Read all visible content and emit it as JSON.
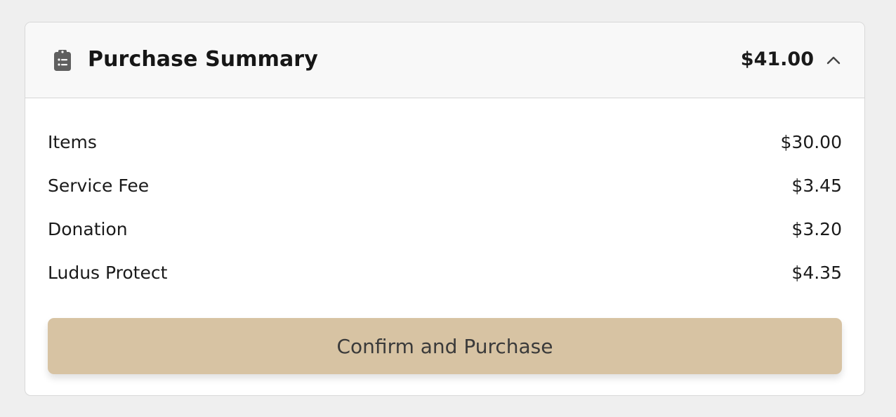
{
  "summary": {
    "title": "Purchase Summary",
    "total": "$41.00",
    "header_icon": "clipboard-list-icon",
    "toggle_icon": "chevron-up-icon",
    "rows": [
      {
        "label": "Items",
        "value": "$30.00"
      },
      {
        "label": "Service Fee",
        "value": "$3.45"
      },
      {
        "label": "Donation",
        "value": "$3.20"
      },
      {
        "label": "Ludus Protect",
        "value": "$4.35"
      }
    ],
    "confirm_label": "Confirm and Purchase"
  },
  "colors": {
    "button_background": "#d7c3a3",
    "header_background": "#f8f8f8",
    "page_background": "#efefef",
    "icon": "#5f5f5f"
  }
}
